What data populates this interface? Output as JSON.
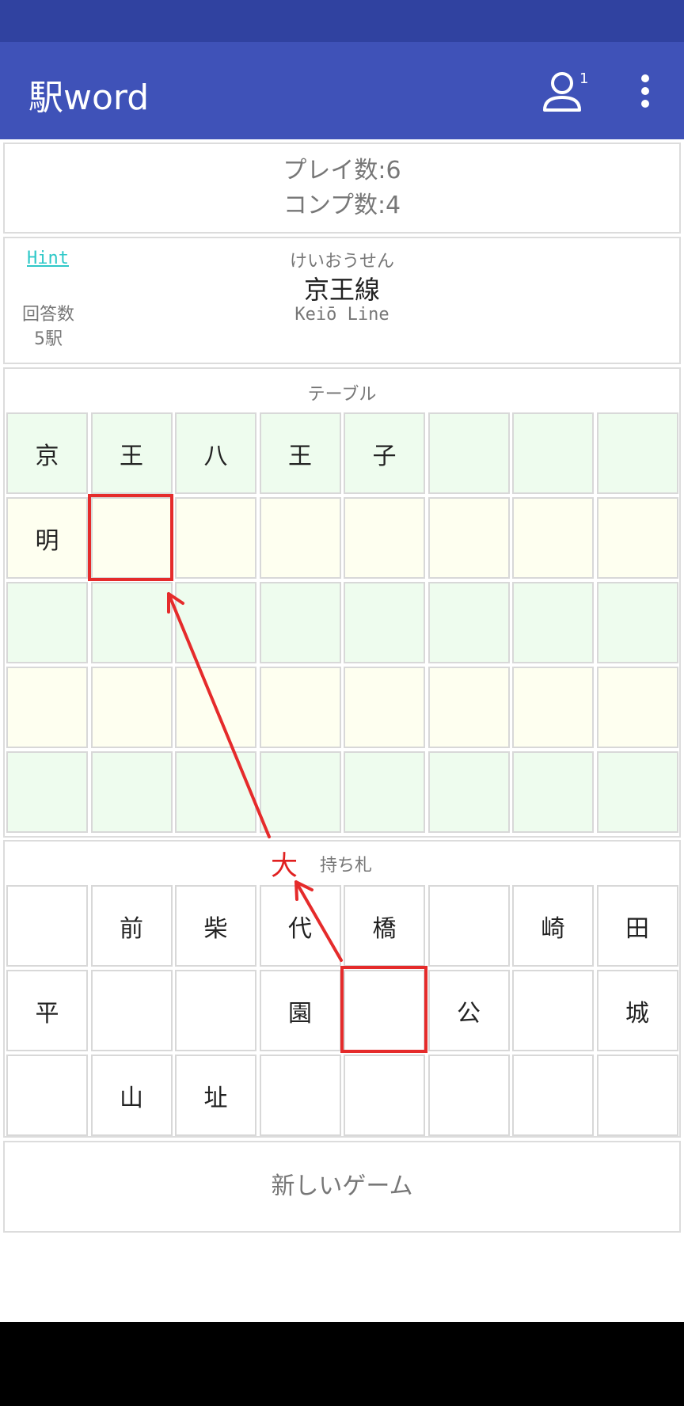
{
  "app": {
    "title": "駅word",
    "user_count": "1"
  },
  "stats": {
    "plays": "プレイ数:6",
    "completions": "コンプ数:4"
  },
  "info": {
    "hint_label": "Hint",
    "answer_label": "回答数",
    "answer_value": "5駅",
    "line_kana": "けいおうせん",
    "line_name": "京王線",
    "line_romaji": "Keiō Line"
  },
  "table": {
    "label": "テーブル",
    "rows": [
      [
        "京",
        "王",
        "八",
        "王",
        "子",
        "",
        "",
        ""
      ],
      [
        "明",
        "",
        "",
        "",
        "",
        "",
        "",
        ""
      ],
      [
        "",
        "",
        "",
        "",
        "",
        "",
        "",
        ""
      ],
      [
        "",
        "",
        "",
        "",
        "",
        "",
        "",
        ""
      ],
      [
        "",
        "",
        "",
        "",
        "",
        "",
        "",
        ""
      ]
    ]
  },
  "hand": {
    "held_char": "大",
    "label": "持ち札",
    "rows": [
      [
        "",
        "前",
        "柴",
        "代",
        "橋",
        "",
        "崎",
        "田"
      ],
      [
        "平",
        "",
        "",
        "園",
        "",
        "公",
        "",
        "城"
      ],
      [
        "",
        "山",
        "址",
        "",
        "",
        "",
        "",
        ""
      ]
    ]
  },
  "actions": {
    "new_game": "新しいゲーム"
  },
  "icons": {
    "user": "user-icon",
    "menu": "more-vert-icon"
  },
  "colors": {
    "app_bar": "#3f52b8",
    "status_bar": "#3042a0",
    "annotation": "#e52b2b",
    "hint": "#2ec8c8"
  }
}
